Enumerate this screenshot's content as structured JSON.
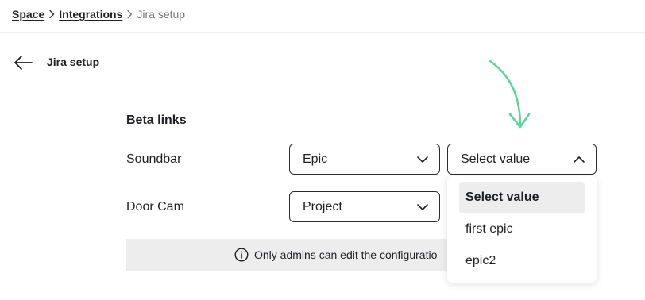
{
  "breadcrumb": {
    "items": [
      "Space",
      "Integrations"
    ],
    "current": "Jira setup",
    "separator_icon": "chevron-right-icon"
  },
  "header": {
    "back_icon": "arrow-left-icon",
    "title": "Jira setup"
  },
  "section": {
    "title": "Beta links"
  },
  "rows": [
    {
      "label": "Soundbar",
      "first_select": "Epic",
      "second_select": "Select value"
    },
    {
      "label": "Door Cam",
      "first_select": "Project"
    }
  ],
  "info": {
    "icon": "info-icon",
    "text": "Only admins can edit the configuratio"
  },
  "dropdown": {
    "options": [
      "Select value",
      "first epic",
      "epic2"
    ],
    "selected": "Select value"
  },
  "colors": {
    "accent_arrow": "#5dd69a",
    "info_bg": "#ededee",
    "border": "#2a2b2f",
    "muted_text": "#75767a"
  }
}
